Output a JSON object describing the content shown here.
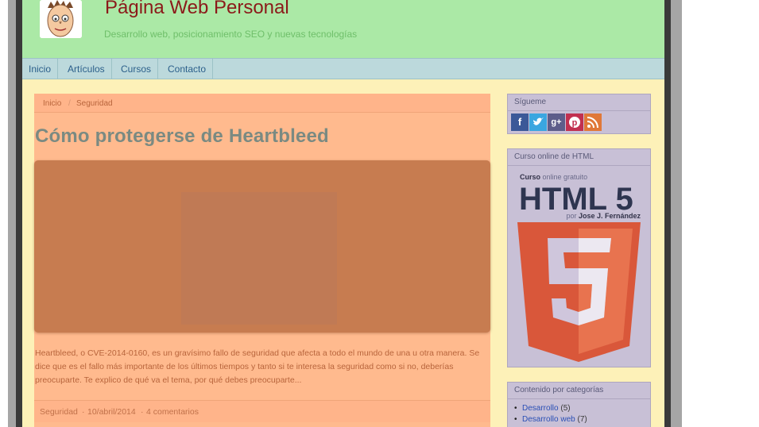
{
  "header": {
    "title": "Página Web Personal",
    "subtitle": "Desarrollo web, posicionamiento SEO y nuevas tecnologías"
  },
  "nav": [
    {
      "label": "Inicio"
    },
    {
      "label": "Artículos"
    },
    {
      "label": "Cursos"
    },
    {
      "label": "Contacto"
    }
  ],
  "breadcrumb": {
    "home": "Inicio",
    "separator": "/",
    "current": "Seguridad"
  },
  "post": {
    "title": "Cómo protegerse de Heartbleed",
    "excerpt": "Heartbleed, o CVE-2014-0160, es un gravísimo fallo de seguridad que afecta a todo el mundo de una u otra manera. Se dice que es el fallo más importante de los últimos tiempos y tanto si te interesa la seguridad como si no, deberías preocuparte. Te explico de qué va el tema, por qué debes preocuparte...",
    "meta": {
      "category": "Seguridad",
      "sep1": "·",
      "date": "10/abril/2014",
      "sep2": "·",
      "comments": "4 comentarios"
    }
  },
  "sidebar": {
    "social": {
      "title": "Sígueme",
      "icons": [
        {
          "name": "facebook-icon",
          "glyph": "f",
          "color": "#3b5998"
        },
        {
          "name": "twitter-icon",
          "glyph": "t",
          "color": "#3aa6e0"
        },
        {
          "name": "google-plus-icon",
          "glyph": "g+",
          "color": "#5d5d8a"
        },
        {
          "name": "pinterest-icon",
          "glyph": "p",
          "color": "#c13050"
        },
        {
          "name": "rss-icon",
          "glyph": "rss",
          "color": "#e07838"
        }
      ]
    },
    "course": {
      "title": "Curso online de HTML",
      "kicker_bold": "Curso",
      "kicker_rest": "online gratuito",
      "headline": "HTML 5",
      "byline_pre": "por",
      "byline_name": "Jose J. Fernández",
      "shield_number": "5"
    },
    "categories": {
      "title": "Contenido por categorías",
      "items": [
        {
          "label": "Desarrollo",
          "count": "(5)"
        },
        {
          "label": "Desarrollo web",
          "count": "(7)"
        }
      ]
    }
  }
}
